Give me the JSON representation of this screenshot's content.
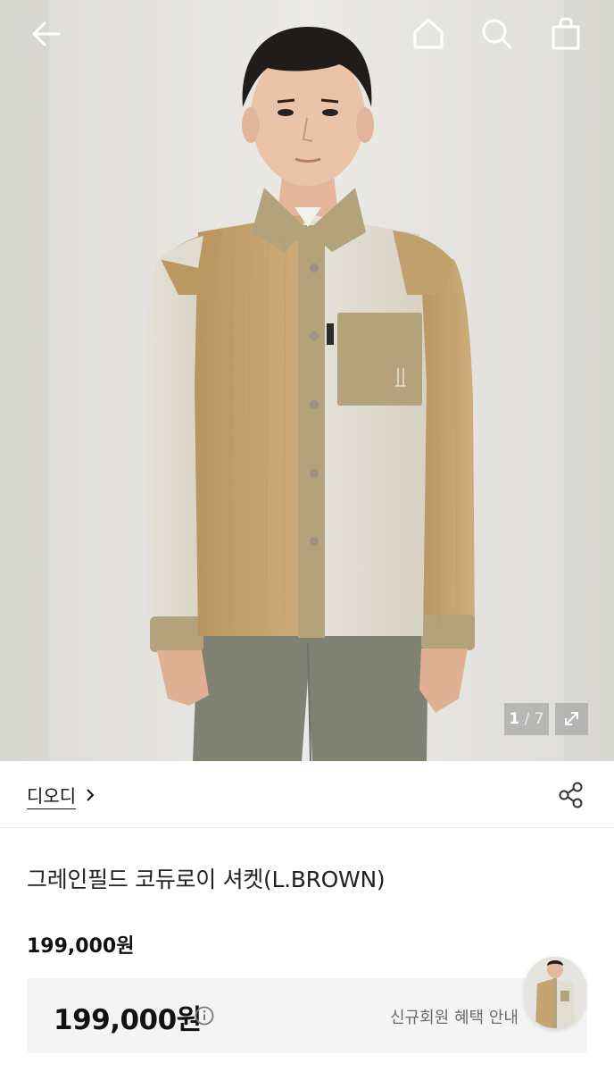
{
  "header": {
    "back_icon": "arrow-left-icon",
    "home_icon": "home-icon",
    "search_icon": "search-icon",
    "cart_icon": "shopping-bag-icon"
  },
  "gallery": {
    "current": "1",
    "separator": "/",
    "total": "7",
    "expand_icon": "expand-icon"
  },
  "brand": {
    "name": "디오디",
    "chevron": "chevron-right-icon",
    "share_icon": "share-icon"
  },
  "product": {
    "title": "그레인필드 코듀로이 셔켓(L.BROWN)",
    "price": "199,000원",
    "sale_price": "199,000원",
    "benefit_link": "신규회원 혜택 안내"
  },
  "colors": {
    "text": "#111111",
    "muted": "#6b6b6b",
    "price_box_bg": "#f4f4f5",
    "jacket_tan": "#c4a472",
    "jacket_cream": "#e2ddd1",
    "trim_olive": "#b3a27a",
    "pants": "#7f8273"
  }
}
